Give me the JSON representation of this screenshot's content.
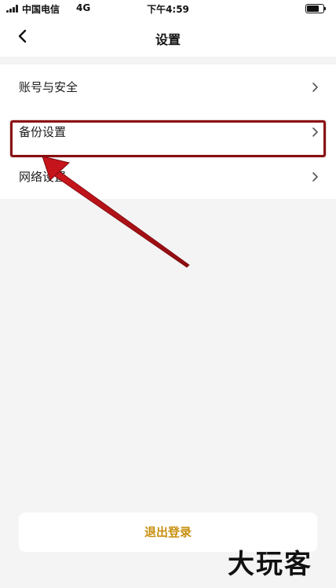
{
  "status_bar": {
    "carrier": "中国电信",
    "network": "4G",
    "time": "下午4:59",
    "battery_icon": "battery-icon",
    "signal_icon": "signal-icon"
  },
  "header": {
    "title": "设置",
    "back_icon": "chevron-left-icon"
  },
  "menu": {
    "items": [
      {
        "label": "账号与安全",
        "icon": "chevron-right-icon"
      },
      {
        "label": "备份设置",
        "icon": "chevron-right-icon",
        "highlighted": true
      },
      {
        "label": "网络设置",
        "icon": "chevron-right-icon"
      }
    ]
  },
  "logout": {
    "label": "退出登录",
    "color": "#c8900f"
  },
  "annotation": {
    "highlight_color": "#8a0e12",
    "arrow_color": "#b5141a"
  },
  "watermark": {
    "text": "大玩客"
  },
  "colors": {
    "background": "#f4f4f4",
    "surface": "#ffffff"
  }
}
